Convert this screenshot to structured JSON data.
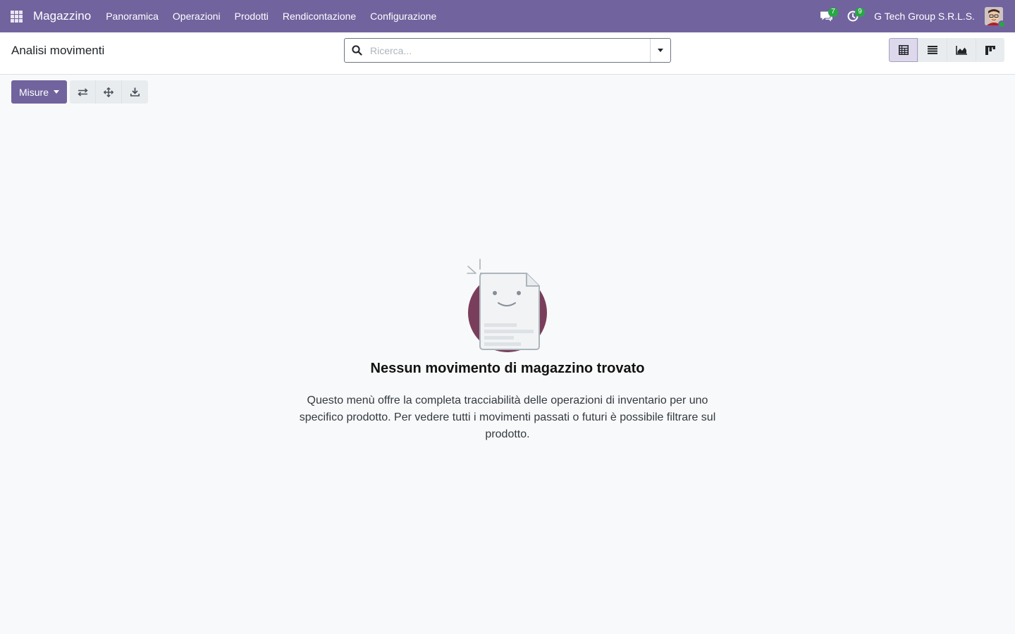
{
  "app": {
    "title": "Magazzino"
  },
  "menu": [
    {
      "label": "Panoramica"
    },
    {
      "label": "Operazioni"
    },
    {
      "label": "Prodotti"
    },
    {
      "label": "Rendicontazione"
    },
    {
      "label": "Configurazione"
    }
  ],
  "systray": {
    "messages_count": "7",
    "activities_count": "9",
    "company": "G Tech Group S.R.L.S."
  },
  "control_panel": {
    "title": "Analisi movimenti",
    "search_placeholder": "Ricerca..."
  },
  "views": [
    {
      "icon": "pivot-table-icon",
      "active": true
    },
    {
      "icon": "list-view-icon",
      "active": false
    },
    {
      "icon": "area-chart-icon",
      "active": false
    },
    {
      "icon": "kanban-view-icon",
      "active": false
    }
  ],
  "actions": {
    "measures_label": "Misure",
    "tools": [
      "flip-axis-icon",
      "expand-all-icon",
      "download-icon"
    ]
  },
  "empty_state": {
    "title": "Nessun movimento di magazzino trovato",
    "text": "Questo menù offre la completa tracciabilità delle operazioni di inventario per uno specifico prodotto. Per vedere tutti i movimenti passati o futuri è possibile filtrare sul prodotto."
  },
  "colors": {
    "brand": "#71639e",
    "badge": "#28a745",
    "illustration_circle": "#7a3e5d"
  }
}
